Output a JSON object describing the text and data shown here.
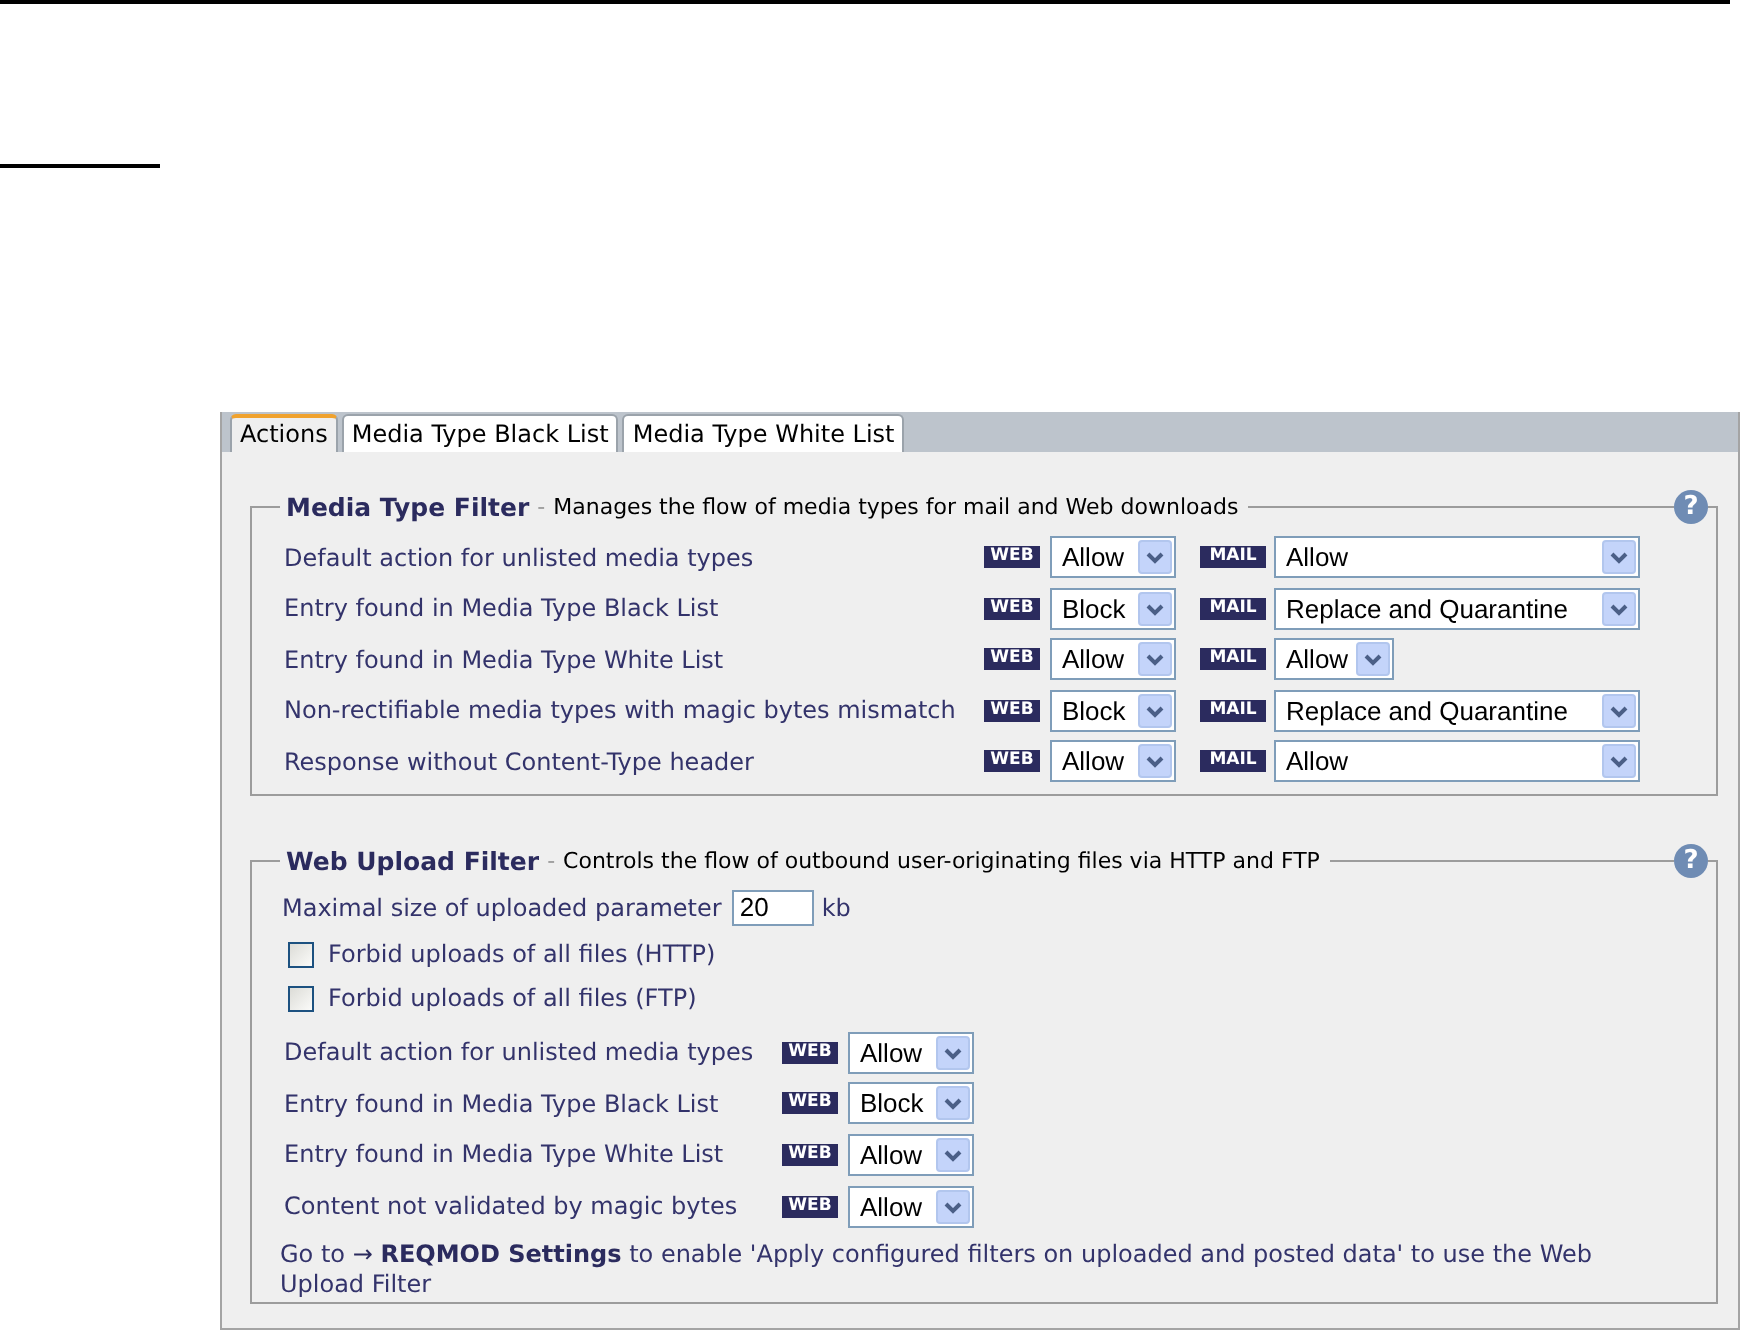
{
  "tabs": [
    {
      "label": "Actions",
      "selected": true
    },
    {
      "label": "Media Type Black List",
      "selected": false
    },
    {
      "label": "Media Type White List",
      "selected": false
    }
  ],
  "media_type_filter": {
    "title": "Media Type Filter",
    "separator": "-",
    "description": "Manages the flow of media types for mail and Web downloads",
    "help": "?",
    "rows": [
      {
        "label": "Default action for unlisted media types",
        "web": {
          "badge": "WEB",
          "value": "Allow"
        },
        "mail": {
          "badge": "MAIL",
          "value": "Allow",
          "kind": "wide"
        }
      },
      {
        "label": "Entry found in Media Type Black List",
        "web": {
          "badge": "WEB",
          "value": "Block"
        },
        "mail": {
          "badge": "MAIL",
          "value": "Replace and Quarantine",
          "kind": "wide"
        }
      },
      {
        "label": "Entry found in Media Type White List",
        "web": {
          "badge": "WEB",
          "value": "Allow"
        },
        "mail": {
          "badge": "MAIL",
          "value": "Allow",
          "kind": "compact"
        }
      },
      {
        "label": "Non-rectifiable media types with magic bytes mismatch",
        "web": {
          "badge": "WEB",
          "value": "Block"
        },
        "mail": {
          "badge": "MAIL",
          "value": "Replace and Quarantine",
          "kind": "wide"
        }
      },
      {
        "label": "Response without Content-Type header",
        "web": {
          "badge": "WEB",
          "value": "Allow"
        },
        "mail": {
          "badge": "MAIL",
          "value": "Allow",
          "kind": "wide"
        }
      }
    ]
  },
  "web_upload_filter": {
    "title": "Web Upload Filter",
    "separator": "-",
    "description": "Controls the flow of outbound user-originating files via HTTP and FTP",
    "help": "?",
    "max_size": {
      "label": "Maximal size of uploaded parameter",
      "value": "20",
      "unit": "kb"
    },
    "checkboxes": [
      {
        "label": "Forbid uploads of all files (HTTP)",
        "checked": false
      },
      {
        "label": "Forbid uploads of all files (FTP)",
        "checked": false
      }
    ],
    "rows": [
      {
        "label": "Default action for unlisted media types",
        "badge": "WEB",
        "value": "Allow"
      },
      {
        "label": "Entry found in Media Type Black List",
        "badge": "WEB",
        "value": "Block"
      },
      {
        "label": "Entry found in Media Type White List",
        "badge": "WEB",
        "value": "Allow"
      },
      {
        "label": "Content not validated by magic bytes",
        "badge": "WEB",
        "value": "Allow"
      }
    ],
    "note": {
      "before": "Go to",
      "link": "→ **REQMOD Settings**",
      "after": "to enable 'Apply configured filters on uploaded and posted data' to use the Web Upload Filter"
    }
  }
}
